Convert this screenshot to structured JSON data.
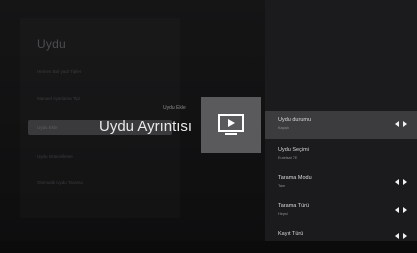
{
  "left": {
    "title": "Uydu",
    "items": [
      "Hemen Bul yadı Tipler",
      "Manuel Ayarlama Tipi",
      "Uydu Ekle",
      "Uydu Güncelleme",
      "Otomatik Uydu Tarama"
    ]
  },
  "overlay": {
    "caption": "Uydu Ekle",
    "title": "Uydu Ayrıntısı",
    "tile_icon": "tv-play-icon"
  },
  "panel": {
    "items": [
      {
        "label": "Uydu durumu",
        "value": "Kapalı",
        "arrows": true
      },
      {
        "label": "Uydu Seçimi",
        "value": "Eutelsat 7E",
        "arrows": false
      },
      {
        "label": "Tarama Modu",
        "value": "Tam",
        "arrows": true
      },
      {
        "label": "Tarama Türü",
        "value": "Hepsi",
        "arrows": true
      },
      {
        "label": "Kayıt Türü",
        "value": "",
        "arrows": true
      }
    ]
  },
  "colors": {
    "panel_bg": "#1b1b1d",
    "active_row": "#3c3c3f",
    "tile_bg": "#5a5a5d"
  }
}
